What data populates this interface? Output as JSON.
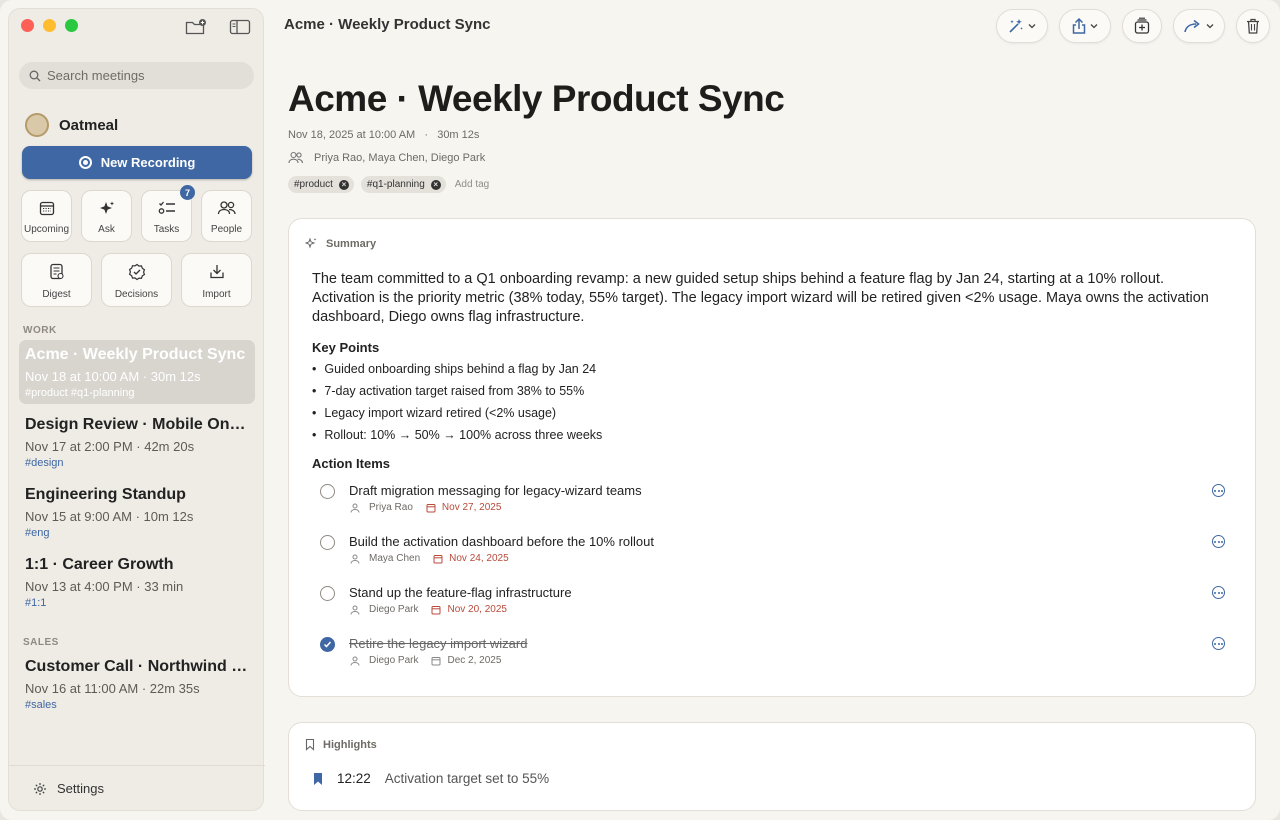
{
  "window": {
    "title": "Acme · Weekly Product Sync"
  },
  "sidebar": {
    "search_placeholder": "Search meetings",
    "brand": "Oatmeal",
    "new_recording": "New Recording",
    "tiles": [
      {
        "label": "Upcoming"
      },
      {
        "label": "Ask"
      },
      {
        "label": "Tasks",
        "badge": "7"
      },
      {
        "label": "People"
      },
      {
        "label": "Digest"
      },
      {
        "label": "Decisions"
      },
      {
        "label": "Import"
      }
    ],
    "sections": [
      {
        "label": "WORK"
      },
      {
        "label": "SALES"
      }
    ],
    "meetings": [
      {
        "title": "Acme · Weekly Product Sync",
        "meta": "Nov 18 at 10:00 AM  ·  30m 12s",
        "tags": "#product #q1-planning"
      },
      {
        "title": "Design Review · Mobile Onboarding",
        "meta": "Nov 17 at 2:00 PM  ·  42m 20s",
        "tags": "#design"
      },
      {
        "title": "Engineering Standup",
        "meta": "Nov 15 at 9:00 AM  ·  10m 12s",
        "tags": "#eng"
      },
      {
        "title": "1:1 · Career Growth",
        "meta": "Nov 13 at 4:00 PM  ·  33 min",
        "tags": "#1:1"
      },
      {
        "title": "Customer Call · Northwind Traders",
        "meta": "Nov 16 at 11:00 AM  ·  22m 35s",
        "tags": "#sales"
      }
    ],
    "settings": "Settings"
  },
  "doc": {
    "title": "Acme · Weekly Product Sync",
    "meta": "Nov 18, 2025 at 10:00 AM   ·   30m 12s",
    "attendees": "Priya Rao, Maya Chen, Diego Park",
    "tags": [
      "#product",
      "#q1-planning"
    ],
    "add_tag": "Add tag"
  },
  "summary": {
    "label": "Summary",
    "text": "The team committed to a Q1 onboarding revamp: a new guided setup ships behind a feature flag by Jan 24, starting at a 10% rollout. Activation is the priority metric (38% today, 55% target). The legacy import wizard will be retired given <2% usage. Maya owns the activation dashboard, Diego owns flag infrastructure.",
    "key_points_heading": "Key Points",
    "key_points": [
      "Guided onboarding ships behind a flag by Jan 24",
      "7-day activation target raised from 38% to 55%",
      "Legacy import wizard retired (<2% usage)",
      "Rollout: 10% → 50% → 100% across three weeks"
    ],
    "action_items_heading": "Action Items",
    "action_items": [
      {
        "text": "Draft migration messaging for legacy-wizard teams",
        "owner": "Priya Rao",
        "date": "Nov 27, 2025",
        "done": false
      },
      {
        "text": "Build the activation dashboard before the 10% rollout",
        "owner": "Maya Chen",
        "date": "Nov 24, 2025",
        "done": false
      },
      {
        "text": "Stand up the feature-flag infrastructure",
        "owner": "Diego Park",
        "date": "Nov 20, 2025",
        "done": false
      },
      {
        "text": "Retire the legacy import wizard",
        "owner": "Diego Park",
        "date": "Dec 2, 2025",
        "done": true
      }
    ]
  },
  "highlights": {
    "label": "Highlights",
    "items": [
      {
        "time": "12:22",
        "text": "Activation target set to 55%"
      }
    ]
  },
  "colors": {
    "accent": "#3e67a3",
    "due": "#b84a3a"
  }
}
